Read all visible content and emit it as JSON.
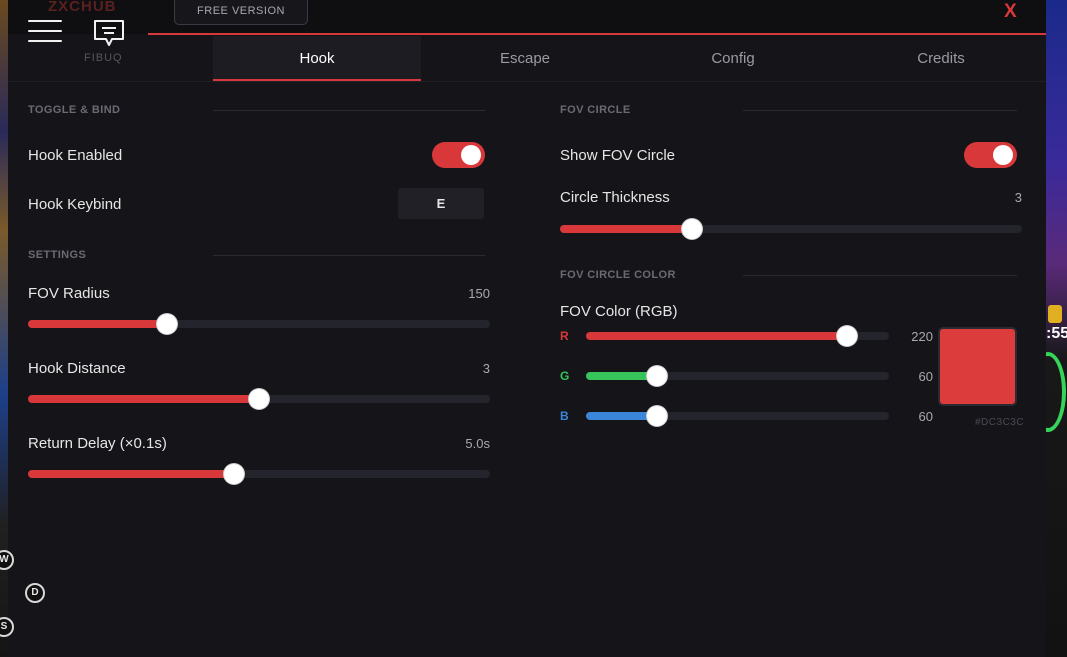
{
  "app": {
    "brand": "ZXCHUB",
    "brand_sub": "FIBUQ",
    "version_label": "FREE VERSION",
    "close_label": "X"
  },
  "tabs": [
    {
      "label": "Hook",
      "active": true
    },
    {
      "label": "Escape",
      "active": false
    },
    {
      "label": "Config",
      "active": false
    },
    {
      "label": "Credits",
      "active": false
    }
  ],
  "left": {
    "toggle_section": "TOGGLE & BIND",
    "hook_enabled": {
      "label": "Hook Enabled",
      "on": true
    },
    "hook_keybind": {
      "label": "Hook Keybind",
      "key": "E"
    },
    "settings_section": "SETTINGS",
    "fov_radius": {
      "label": "FOV Radius",
      "value_text": "150",
      "fraction": 0.3
    },
    "hook_distance": {
      "label": "Hook Distance",
      "value_text": "3",
      "fraction": 0.5
    },
    "return_delay": {
      "label": "Return Delay (×0.1s)",
      "value_text": "5.0s",
      "fraction": 0.445
    }
  },
  "right": {
    "fov_section": "FOV CIRCLE",
    "show_fov": {
      "label": "Show FOV Circle",
      "on": true
    },
    "circle_thickness": {
      "label": "Circle Thickness",
      "value_text": "3",
      "fraction": 0.285
    },
    "color_section": "FOV CIRCLE COLOR",
    "fov_color": {
      "label": "FOV Color (RGB)",
      "r": {
        "letter": "R",
        "value_text": "220",
        "fraction": 0.86,
        "color": "#d9383a"
      },
      "g": {
        "letter": "G",
        "value_text": "60",
        "fraction": 0.235,
        "color": "#37c45a"
      },
      "b": {
        "letter": "B",
        "value_text": "60",
        "fraction": 0.235,
        "color": "#3a86d9"
      },
      "swatch_color": "#DC3C3C",
      "hex": "#DC3C3C"
    }
  },
  "game_overlay": {
    "keys": [
      "W",
      "D",
      "S"
    ],
    "right_label": ":55"
  },
  "colors": {
    "accent": "#d9383a",
    "panel": "#151519"
  }
}
